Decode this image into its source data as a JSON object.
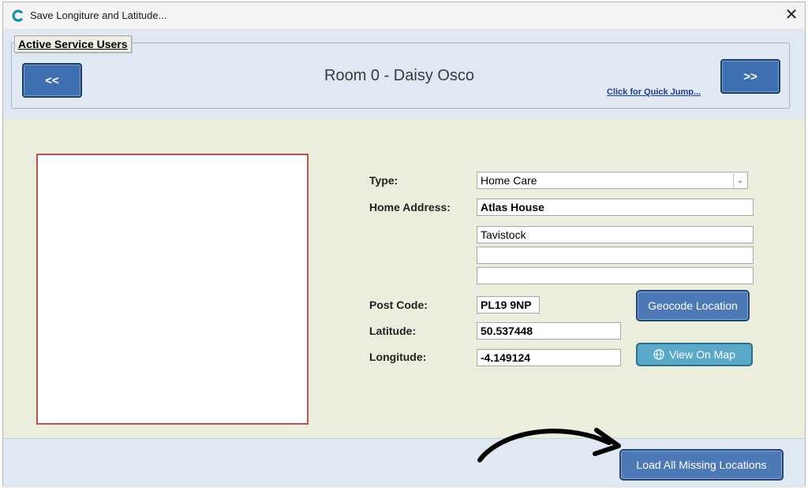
{
  "window": {
    "title": "Save Longiture and Latitude...",
    "close_glyph": "✕"
  },
  "header": {
    "group_label": "Active Service Users",
    "prev_label": "<<",
    "next_label": ">>",
    "room_title": "Room 0 - Daisy Osco",
    "quick_jump_label": "Click for Quick Jump..."
  },
  "form": {
    "type_label": "Type:",
    "type_value": "Home Care",
    "home_address_label": "Home Address:",
    "address_lines": [
      "Atlas House",
      "Tavistock",
      "",
      ""
    ],
    "post_code_label": "Post Code:",
    "post_code_value": "PL19 9NP",
    "latitude_label": "Latitude:",
    "latitude_value": "50.537448",
    "longitude_label": "Longitude:",
    "longitude_value": "-4.149124"
  },
  "buttons": {
    "geocode_label": "Geocode Location",
    "view_map_label": "View On Map",
    "load_missing_label": "Load All Missing Locations"
  },
  "icons": {
    "app_icon": "app-logo-icon",
    "globe_icon": "globe-icon",
    "annotation": "curved-arrow-annotation"
  },
  "colors": {
    "primary_button": "#4d7ab7",
    "map_button": "#5aa9c8",
    "photo_border": "#c24f4a",
    "main_background": "#ebeedd",
    "band_background": "#dfe8f3"
  }
}
